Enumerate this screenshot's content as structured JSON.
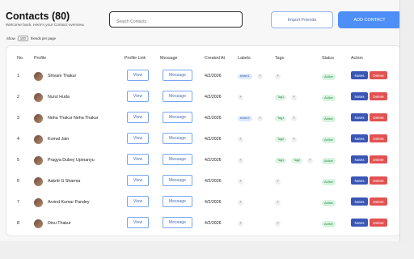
{
  "header": {
    "title": "Contacts (80)",
    "subtitle": "Welcome back, Here's your Contact overview."
  },
  "search": {
    "placeholder": "Search Contacts"
  },
  "actions": {
    "import_label": "Import Friends",
    "add_label": "ADD CONTACT"
  },
  "pagination": {
    "show_label": "Show",
    "page_size": "100",
    "per_page_label": "friends per page"
  },
  "table": {
    "columns": [
      "No.",
      "Profile",
      "Profile Link",
      "Message",
      "Created At",
      "Labels",
      "Tags",
      "Status",
      "Action"
    ],
    "rows": [
      {
        "no": "1",
        "name": "Shivani Thakur",
        "view": "View",
        "message": "Message",
        "created": "4/2/2026",
        "labels": [
          "tester1"
        ],
        "tags": [],
        "status": "Active",
        "notes": "Notes",
        "delete": "Delete"
      },
      {
        "no": "2",
        "name": "Nurul Huda",
        "view": "View",
        "message": "Message",
        "created": "4/2/2026",
        "labels": [],
        "tags": [
          "Tag1"
        ],
        "status": "Active",
        "notes": "Notes",
        "delete": "Delete"
      },
      {
        "no": "3",
        "name": "Neha Thakur Neha Thakur",
        "view": "View",
        "message": "Message",
        "created": "4/2/2026",
        "labels": [
          "tester2"
        ],
        "tags": [
          "Tag1"
        ],
        "status": "Active",
        "notes": "Notes",
        "delete": "Delete"
      },
      {
        "no": "4",
        "name": "Komal Jain",
        "view": "View",
        "message": "Message",
        "created": "4/2/2026",
        "labels": [],
        "tags": [
          "Tag2"
        ],
        "status": "Active",
        "notes": "Notes",
        "delete": "Delete"
      },
      {
        "no": "5",
        "name": "Pragya Dubey Upmanyu",
        "view": "View",
        "message": "Message",
        "created": "4/2/2026",
        "labels": [],
        "tags": [
          "Tag1",
          "Tag2"
        ],
        "status": "Active",
        "notes": "Notes",
        "delete": "Delete"
      },
      {
        "no": "6",
        "name": "Aakriti G Sharma",
        "view": "View",
        "message": "Message",
        "created": "4/2/2026",
        "labels": [],
        "tags": [],
        "status": "Active",
        "notes": "Notes",
        "delete": "Delete"
      },
      {
        "no": "7",
        "name": "Arvind Kumar Pandey",
        "view": "View",
        "message": "Message",
        "created": "4/2/2026",
        "labels": [],
        "tags": [],
        "status": "Active",
        "notes": "Notes",
        "delete": "Delete"
      },
      {
        "no": "8",
        "name": "Dinu Thakur",
        "view": "View",
        "message": "Message",
        "created": "4/2/2026",
        "labels": [],
        "tags": [],
        "status": "Active",
        "notes": "Notes",
        "delete": "Delete"
      }
    ]
  },
  "colors": {
    "primary": "#4d8ef7",
    "notes": "#3a56b5",
    "delete": "#e25252",
    "status_bg": "#d7f3df",
    "status_text": "#1e8a45"
  }
}
